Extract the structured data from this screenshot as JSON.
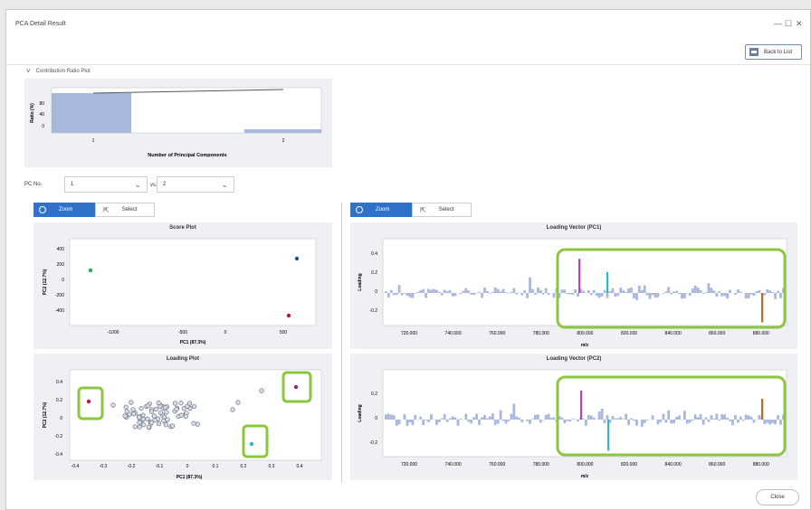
{
  "window": {
    "title": "PCA Detail Result",
    "minimize": "—",
    "maximize": "☐",
    "close": "✕"
  },
  "toolbar": {
    "back_label": "Back to List"
  },
  "contribution": {
    "header": "Contribution Ratio Plot",
    "chevron": "˅",
    "ylabel": "Ratio (%)",
    "xlabel": "Number of Principal Components",
    "yticks": [
      "80",
      "40",
      "0"
    ],
    "xticks": [
      "1",
      "2"
    ]
  },
  "pc_selector": {
    "label": "PC No.",
    "first": "1",
    "vs_label": "vs.",
    "second": "2"
  },
  "left_tools": {
    "zoom": "Zoom",
    "select": "Select"
  },
  "right_tools": {
    "zoom": "Zoom",
    "select": "Select"
  },
  "score_plot": {
    "title": "Score Plot",
    "ylabel": "PC2 (12.7%)",
    "xlabel": "PC1 (87.3%)",
    "yticks": [
      "400",
      "200",
      "0",
      "-200",
      "-400"
    ],
    "xticks": [
      "-1000",
      "-500",
      "0",
      "500"
    ]
  },
  "loading_plot": {
    "title": "Loading Plot",
    "ylabel": "PC2 (12.7%)",
    "xlabel": "PC1 (87.3%)",
    "yticks": [
      "0.4",
      "0.2",
      "0",
      "-0.2",
      "-0.4"
    ],
    "xticks": [
      "-0.4",
      "-0.3",
      "-0.2",
      "-0.1",
      "0",
      "0.1",
      "0.2",
      "0.3",
      "0.4"
    ]
  },
  "loading_pc1": {
    "title": "Loading Vector (PC1)",
    "ylabel": "Loading",
    "xlabel": "m/z",
    "yticks": [
      "0.4",
      "0.2",
      "0",
      "-0.2"
    ],
    "xticks": [
      "720.000",
      "740.000",
      "760.000",
      "780.000",
      "800.000",
      "820.000",
      "840.000",
      "860.000",
      "880.000"
    ]
  },
  "loading_pc2": {
    "title": "Loading Vector (PC2)",
    "ylabel": "Loading",
    "xlabel": "m/z",
    "yticks": [
      "0.2",
      "0",
      "-0.2"
    ],
    "xticks": [
      "720.000",
      "740.000",
      "760.000",
      "780.000",
      "800.000",
      "820.000",
      "840.000",
      "860.000",
      "880.000"
    ]
  },
  "colors": {
    "accent": "#2f72c9",
    "highlight": "#8cc63f",
    "bar": "#a8b8dc",
    "magenta": "#c03cc0",
    "cyan": "#2fb7c9",
    "orange": "#c8641e",
    "green": "#22b14c",
    "red": "#c0143c",
    "navy": "#1f4e8c"
  },
  "footer": {
    "close_label": "Close"
  }
}
